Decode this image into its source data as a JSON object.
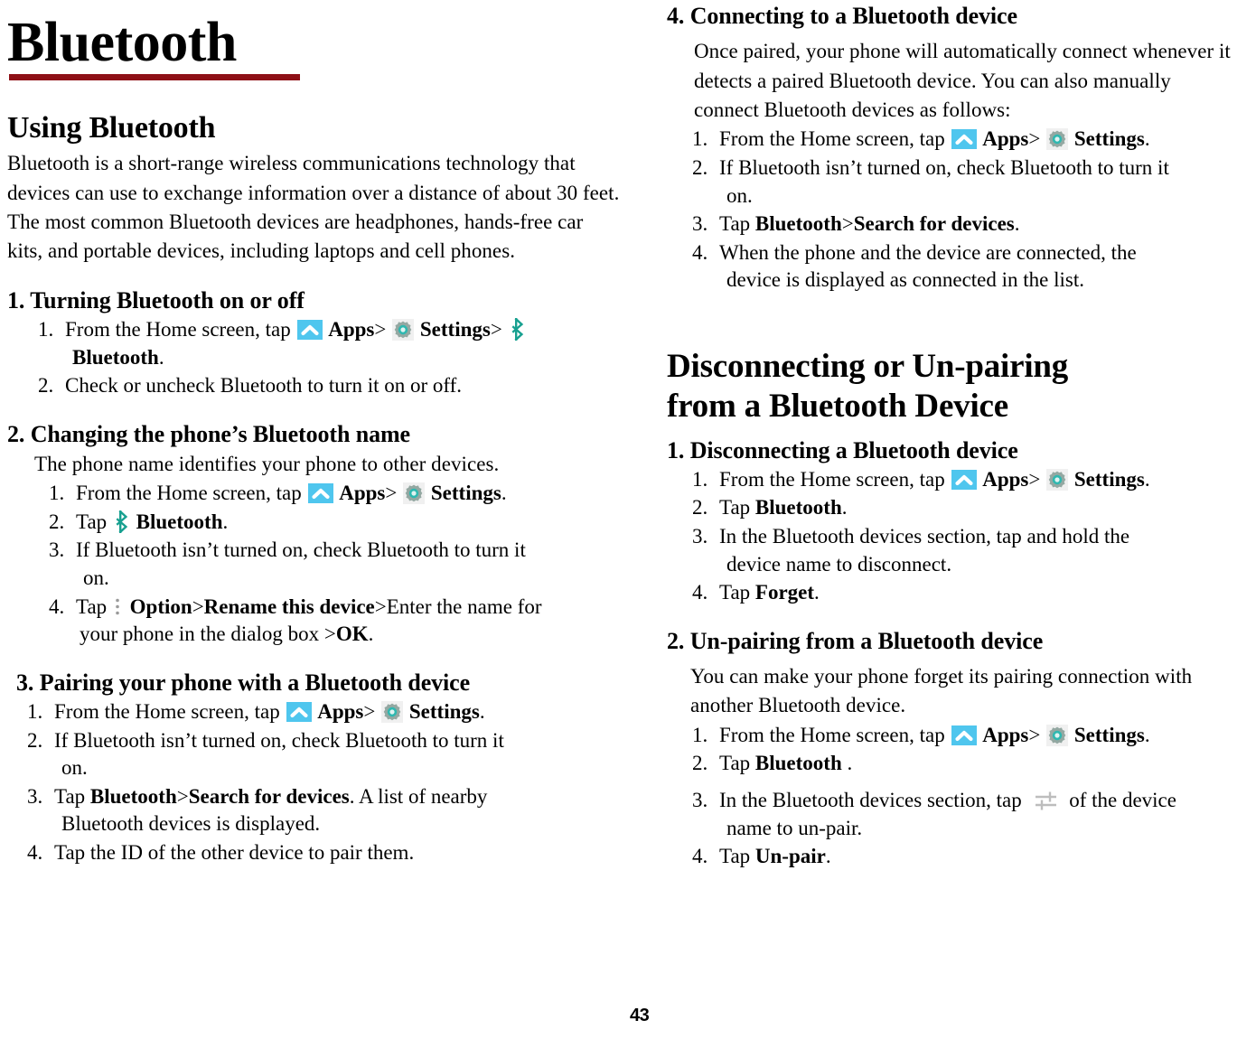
{
  "document": {
    "title": "Bluetooth",
    "page_number": "43",
    "title_rule_color": "#8e1016"
  },
  "icons": {
    "apps": {
      "name": "apps-icon",
      "glyph": "chevron-up",
      "bg": "#4FC6EE",
      "fg": "#ffffff"
    },
    "settings": {
      "name": "settings-gear-icon",
      "glyph": "gear",
      "body": "#8fa39c",
      "ring": "#2fb8b0"
    },
    "bluetooth": {
      "name": "bluetooth-icon",
      "glyph": "bluetooth-rune",
      "color": "#17a090"
    },
    "option": {
      "name": "kebab-menu-icon",
      "glyph": "three-vertical-dots",
      "color": "#9a9a9a"
    },
    "sliders": {
      "name": "sliders-settings-icon",
      "glyph": "adjust-sliders",
      "color": "#b8b8b8"
    }
  },
  "left_column": {
    "section_using": {
      "heading": "Using Bluetooth",
      "intro": "Bluetooth is a short-range wireless communications technology that devices can use to exchange information over a distance of about 30 feet. The most common Bluetooth devices are headphones, hands-free car kits, and portable devices, including laptops and cell phones."
    },
    "sec1": {
      "heading": "1. Turning Bluetooth on or off",
      "steps": [
        {
          "num": "1.",
          "pre": "From the Home screen, tap",
          "icons": [
            "apps",
            "settings",
            "bluetooth"
          ],
          "apps_label": "Apps",
          "sep": ">",
          "settings_label": "Settings",
          "sep2": ">",
          "bt_label": "Bluetooth",
          "post": "."
        },
        {
          "num": "2.",
          "text": "Check or uncheck Bluetooth to turn it on or off."
        }
      ]
    },
    "sec2": {
      "heading": "2. Changing the phone’s Bluetooth name",
      "lead": "The phone name identifies your phone to other devices.",
      "steps": [
        {
          "num": "1.",
          "pre": "From the Home screen, tap",
          "apps_label": "Apps",
          "sep": ">",
          "settings_label": "Settings",
          "post": "."
        },
        {
          "num": "2.",
          "pre": "Tap",
          "bt_label": "Bluetooth",
          "post": "."
        },
        {
          "num": "3.",
          "text": "If Bluetooth isn’t turned on, check Bluetooth to turn it",
          "cont": "on."
        },
        {
          "num": "4.",
          "pre": "Tap",
          "opt_label": "Option",
          "sep": ">",
          "rename_label": "Rename this device",
          "sep2": ">",
          "mid": "Enter the name for",
          "cont": "your phone in the dialog box >",
          "ok_label": "OK",
          "post": "."
        }
      ]
    },
    "sec3": {
      "heading": "3. Pairing your phone with a Bluetooth device",
      "steps": [
        {
          "num": "1.",
          "pre": "From the Home screen, tap",
          "apps_label": "Apps",
          "sep": ">",
          "settings_label": "Settings",
          "post": "."
        },
        {
          "num": "2.",
          "text": "If Bluetooth isn’t turned on, check Bluetooth to turn it",
          "cont": "on."
        },
        {
          "num": "3.",
          "pre": "Tap",
          "bt_label": "Bluetooth",
          "sep": ">",
          "search_label": "Search for devices",
          "mid": ". A list of nearby",
          "cont": "Bluetooth devices is displayed."
        },
        {
          "num": "4.",
          "text": "Tap the ID of the other device to pair them."
        }
      ]
    }
  },
  "right_column": {
    "sec4": {
      "heading": "4. Connecting to a Bluetooth device",
      "lead": "Once paired, your phone will automatically connect whenever it detects a paired Bluetooth device. You can also manually connect Bluetooth devices as follows:",
      "steps": [
        {
          "num": "1.",
          "pre": "From the Home screen, tap",
          "apps_label": "Apps",
          "sep": ">",
          "settings_label": "Settings",
          "post": "."
        },
        {
          "num": "2.",
          "text": "If Bluetooth isn’t turned on, check Bluetooth to turn it",
          "cont": "on."
        },
        {
          "num": "3.",
          "pre": "Tap",
          "bt_label": "Bluetooth",
          "sep": ">",
          "search_label": "Search for devices",
          "post": "."
        },
        {
          "num": "4.",
          "text": "When the phone and the device are connected, the",
          "cont": "device is displayed as connected in the list."
        }
      ]
    },
    "section_disconnect": {
      "heading_line1": "Disconnecting or Un-pairing",
      "heading_line2": "from a Bluetooth Device"
    },
    "sub1": {
      "heading": "1. Disconnecting a Bluetooth device",
      "steps": [
        {
          "num": "1.",
          "pre": "From the Home screen, tap",
          "apps_label": "Apps",
          "sep": ">",
          "settings_label": "Settings",
          "post": "."
        },
        {
          "num": "2.",
          "pre": "Tap",
          "bt_label": "Bluetooth",
          "post": "."
        },
        {
          "num": "3.",
          "text": "In the Bluetooth devices section, tap and hold the",
          "cont": "device name to disconnect."
        },
        {
          "num": "4.",
          "pre": "Tap",
          "forget_label": "Forget",
          "post": "."
        }
      ]
    },
    "sub2": {
      "heading": "2. Un-pairing from a Bluetooth device",
      "lead": "You can make your phone forget its pairing connection with another Bluetooth device.",
      "steps": [
        {
          "num": "1.",
          "pre": "From the Home screen, tap",
          "apps_label": "Apps",
          "sep": ">",
          "settings_label": "Settings",
          "post": "."
        },
        {
          "num": "2.",
          "pre": "Tap",
          "bt_label": "Bluetooth",
          "post": " ."
        },
        {
          "num": "3.",
          "pre": "In the Bluetooth devices section, tap",
          "mid": "of the device",
          "cont": "name to un-pair."
        },
        {
          "num": "4.",
          "pre": "Tap",
          "unpair_label": "Un-pair",
          "post": "."
        }
      ]
    }
  }
}
